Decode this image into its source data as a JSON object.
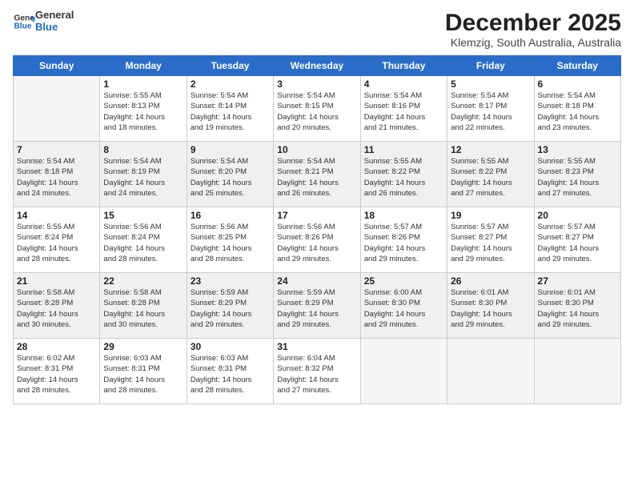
{
  "header": {
    "logo_general": "General",
    "logo_blue": "Blue",
    "month_title": "December 2025",
    "location": "Klemzig, South Australia, Australia"
  },
  "days_of_week": [
    "Sunday",
    "Monday",
    "Tuesday",
    "Wednesday",
    "Thursday",
    "Friday",
    "Saturday"
  ],
  "weeks": [
    [
      {
        "day": "",
        "info": ""
      },
      {
        "day": "1",
        "info": "Sunrise: 5:55 AM\nSunset: 8:13 PM\nDaylight: 14 hours\nand 18 minutes."
      },
      {
        "day": "2",
        "info": "Sunrise: 5:54 AM\nSunset: 8:14 PM\nDaylight: 14 hours\nand 19 minutes."
      },
      {
        "day": "3",
        "info": "Sunrise: 5:54 AM\nSunset: 8:15 PM\nDaylight: 14 hours\nand 20 minutes."
      },
      {
        "day": "4",
        "info": "Sunrise: 5:54 AM\nSunset: 8:16 PM\nDaylight: 14 hours\nand 21 minutes."
      },
      {
        "day": "5",
        "info": "Sunrise: 5:54 AM\nSunset: 8:17 PM\nDaylight: 14 hours\nand 22 minutes."
      },
      {
        "day": "6",
        "info": "Sunrise: 5:54 AM\nSunset: 8:18 PM\nDaylight: 14 hours\nand 23 minutes."
      }
    ],
    [
      {
        "day": "7",
        "info": "Sunrise: 5:54 AM\nSunset: 8:18 PM\nDaylight: 14 hours\nand 24 minutes."
      },
      {
        "day": "8",
        "info": "Sunrise: 5:54 AM\nSunset: 8:19 PM\nDaylight: 14 hours\nand 24 minutes."
      },
      {
        "day": "9",
        "info": "Sunrise: 5:54 AM\nSunset: 8:20 PM\nDaylight: 14 hours\nand 25 minutes."
      },
      {
        "day": "10",
        "info": "Sunrise: 5:54 AM\nSunset: 8:21 PM\nDaylight: 14 hours\nand 26 minutes."
      },
      {
        "day": "11",
        "info": "Sunrise: 5:55 AM\nSunset: 8:22 PM\nDaylight: 14 hours\nand 26 minutes."
      },
      {
        "day": "12",
        "info": "Sunrise: 5:55 AM\nSunset: 8:22 PM\nDaylight: 14 hours\nand 27 minutes."
      },
      {
        "day": "13",
        "info": "Sunrise: 5:55 AM\nSunset: 8:23 PM\nDaylight: 14 hours\nand 27 minutes."
      }
    ],
    [
      {
        "day": "14",
        "info": "Sunrise: 5:55 AM\nSunset: 8:24 PM\nDaylight: 14 hours\nand 28 minutes."
      },
      {
        "day": "15",
        "info": "Sunrise: 5:56 AM\nSunset: 8:24 PM\nDaylight: 14 hours\nand 28 minutes."
      },
      {
        "day": "16",
        "info": "Sunrise: 5:56 AM\nSunset: 8:25 PM\nDaylight: 14 hours\nand 28 minutes."
      },
      {
        "day": "17",
        "info": "Sunrise: 5:56 AM\nSunset: 8:26 PM\nDaylight: 14 hours\nand 29 minutes."
      },
      {
        "day": "18",
        "info": "Sunrise: 5:57 AM\nSunset: 8:26 PM\nDaylight: 14 hours\nand 29 minutes."
      },
      {
        "day": "19",
        "info": "Sunrise: 5:57 AM\nSunset: 8:27 PM\nDaylight: 14 hours\nand 29 minutes."
      },
      {
        "day": "20",
        "info": "Sunrise: 5:57 AM\nSunset: 8:27 PM\nDaylight: 14 hours\nand 29 minutes."
      }
    ],
    [
      {
        "day": "21",
        "info": "Sunrise: 5:58 AM\nSunset: 8:28 PM\nDaylight: 14 hours\nand 30 minutes."
      },
      {
        "day": "22",
        "info": "Sunrise: 5:58 AM\nSunset: 8:28 PM\nDaylight: 14 hours\nand 30 minutes."
      },
      {
        "day": "23",
        "info": "Sunrise: 5:59 AM\nSunset: 8:29 PM\nDaylight: 14 hours\nand 29 minutes."
      },
      {
        "day": "24",
        "info": "Sunrise: 5:59 AM\nSunset: 8:29 PM\nDaylight: 14 hours\nand 29 minutes."
      },
      {
        "day": "25",
        "info": "Sunrise: 6:00 AM\nSunset: 8:30 PM\nDaylight: 14 hours\nand 29 minutes."
      },
      {
        "day": "26",
        "info": "Sunrise: 6:01 AM\nSunset: 8:30 PM\nDaylight: 14 hours\nand 29 minutes."
      },
      {
        "day": "27",
        "info": "Sunrise: 6:01 AM\nSunset: 8:30 PM\nDaylight: 14 hours\nand 29 minutes."
      }
    ],
    [
      {
        "day": "28",
        "info": "Sunrise: 6:02 AM\nSunset: 8:31 PM\nDaylight: 14 hours\nand 28 minutes."
      },
      {
        "day": "29",
        "info": "Sunrise: 6:03 AM\nSunset: 8:31 PM\nDaylight: 14 hours\nand 28 minutes."
      },
      {
        "day": "30",
        "info": "Sunrise: 6:03 AM\nSunset: 8:31 PM\nDaylight: 14 hours\nand 28 minutes."
      },
      {
        "day": "31",
        "info": "Sunrise: 6:04 AM\nSunset: 8:32 PM\nDaylight: 14 hours\nand 27 minutes."
      },
      {
        "day": "",
        "info": ""
      },
      {
        "day": "",
        "info": ""
      },
      {
        "day": "",
        "info": ""
      }
    ]
  ]
}
